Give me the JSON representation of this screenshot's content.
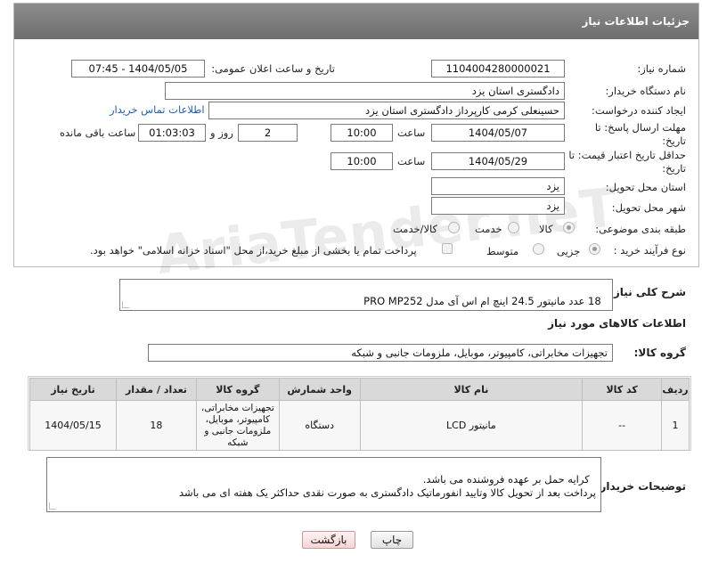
{
  "header": {
    "title": "جزئیات اطلاعات نیاز"
  },
  "form": {
    "need_number_label": "شماره نیاز:",
    "need_number": "1104004280000021",
    "announce_label": "تاریخ و ساعت اعلان عمومی:",
    "announce_value": "1404/05/05 - 07:45",
    "buyer_org_label": "نام دستگاه خریدار:",
    "buyer_org": "دادگستری استان یزد",
    "creator_label": "ایجاد کننده درخواست:",
    "creator": "حسینعلی کرمی کارپرداز دادگستری استان یزد",
    "contact_link": "اطلاعات تماس خریدار",
    "deadline_label": "مهلت ارسال پاسخ: تا تاریخ:",
    "deadline_date": "1404/05/07",
    "time_label": "ساعت",
    "deadline_time": "10:00",
    "days_value": "2",
    "days_label": "روز و",
    "remaining_time": "01:03:03",
    "remaining_label": "ساعت باقی مانده",
    "validity_label": "حداقل تاریخ اعتبار قیمت: تا تاریخ:",
    "validity_date": "1404/05/29",
    "validity_time": "10:00",
    "province_label": "استان محل تحویل:",
    "province": "یزد",
    "city_label": "شهر محل تحویل:",
    "city": "یزد",
    "category_label": "طبقه بندی موضوعی:",
    "category_options": [
      "کالا",
      "خدمت",
      "کالا/خدمت"
    ],
    "process_label": "نوع فرآیند خرید :",
    "process_options": [
      "جزیی",
      "متوسط"
    ],
    "payment_note": "پرداخت تمام یا بخشی از مبلغ خرید،از محل \"اسناد خزانه اسلامی\" خواهد بود."
  },
  "watermark": "AriaTender.neT",
  "summary": {
    "label": "شرح کلی نیاز:",
    "text": "18 عدد مانیتور 24.5 اینچ ام اس آی مدل PRO MP252"
  },
  "goods_section": {
    "title": "اطلاعات کالاهای مورد نیاز"
  },
  "goods_group": {
    "label": "گروه کالا:",
    "value": "تجهیزات مخابراتی، کامپیوتر، موبایل، ملزومات جانبی و شبکه"
  },
  "table": {
    "headers": [
      "ردیف",
      "کد کالا",
      "نام کالا",
      "واحد شمارش",
      "گروه کالا",
      "تعداد / مقدار",
      "تاریخ نیاز"
    ],
    "rows": [
      [
        "1",
        "--",
        "مانیتور LCD",
        "دستگاه",
        "تجهیزات مخابراتی، کامپیوتر، موبایل، ملزومات جانبی و شبکه",
        "18",
        "1404/05/15"
      ]
    ]
  },
  "buyer_notes": {
    "label": "توضیحات خریدار:",
    "text": "کرایه حمل بر عهده فروشنده می باشد.\nپرداخت بعد از تحویل کالا وتایید انفورماتیک دادگستری به صورت نقدی حداکثر یک هفته ای می باشد"
  },
  "buttons": {
    "print": "چاپ",
    "back": "بازگشت"
  }
}
